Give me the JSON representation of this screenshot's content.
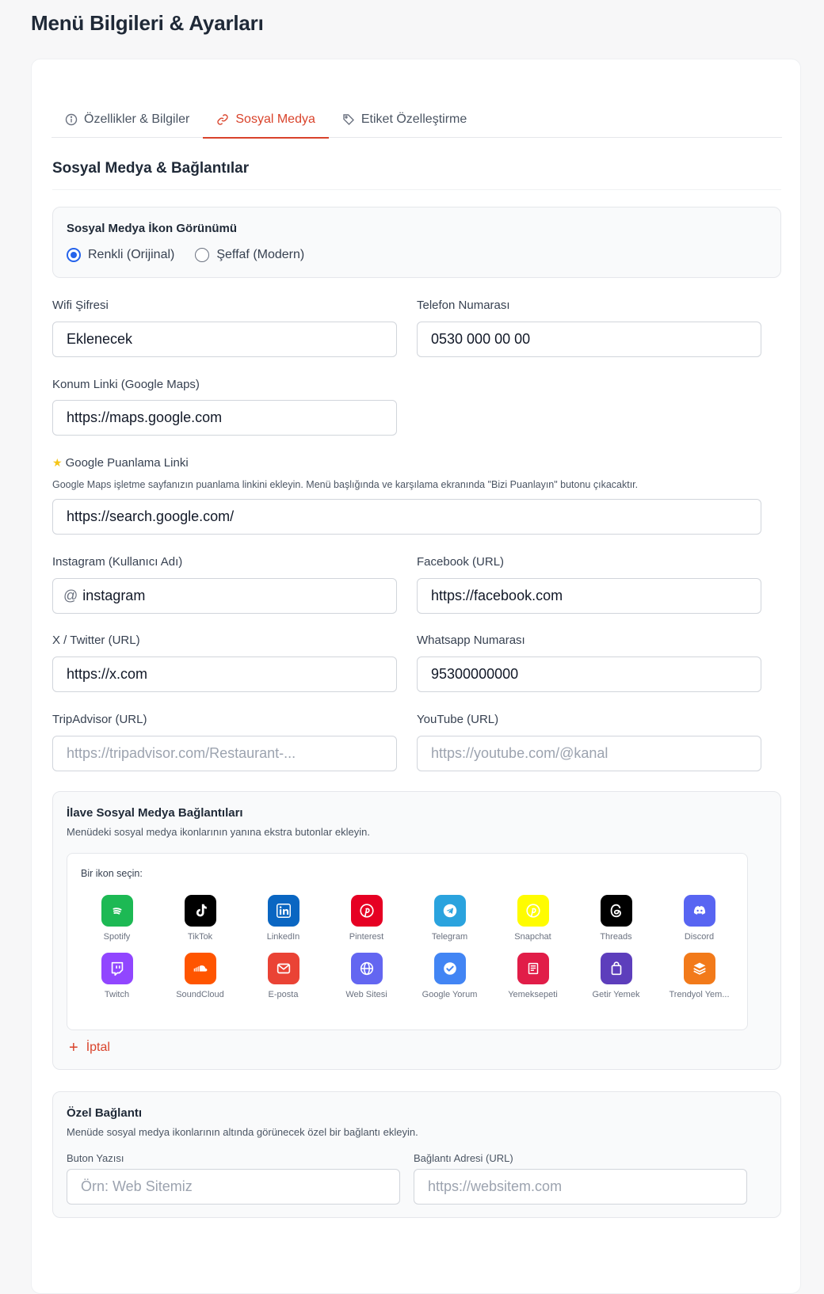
{
  "page_title": "Menü Bilgileri & Ayarları",
  "tabs": [
    {
      "label": "Özellikler & Bilgiler",
      "icon": "info-icon"
    },
    {
      "label": "Sosyal Medya",
      "icon": "link-icon",
      "active": true
    },
    {
      "label": "Etiket Özelleştirme",
      "icon": "tag-icon"
    }
  ],
  "section_title": "Sosyal Medya & Bağlantılar",
  "icon_view": {
    "title": "Sosyal Medya İkon Görünümü",
    "options": [
      {
        "label": "Renkli (Orijinal)",
        "checked": true
      },
      {
        "label": "Şeffaf (Modern)",
        "checked": false
      }
    ]
  },
  "fields": {
    "wifi": {
      "label": "Wifi Şifresi",
      "value": "Eklenecek"
    },
    "phone": {
      "label": "Telefon Numarası",
      "value": "0530 000 00 00"
    },
    "location": {
      "label": "Konum Linki (Google Maps)",
      "value": "https://maps.google.com"
    },
    "rating": {
      "label": "Google Puanlama Linki",
      "help": "Google Maps işletme sayfanızın puanlama linkini ekleyin. Menü başlığında ve karşılama ekranında \"Bizi Puanlayın\" butonu çıkacaktır.",
      "value": "https://search.google.com/"
    },
    "instagram": {
      "label": "Instagram (Kullanıcı Adı)",
      "prefix": "@",
      "value": "instagram"
    },
    "facebook": {
      "label": "Facebook (URL)",
      "value": "https://facebook.com"
    },
    "twitter": {
      "label": "X / Twitter (URL)",
      "value": "https://x.com"
    },
    "whatsapp": {
      "label": "Whatsapp Numarası",
      "value": "95300000000"
    },
    "tripadvisor": {
      "label": "TripAdvisor (URL)",
      "placeholder": "https://tripadvisor.com/Restaurant-..."
    },
    "youtube": {
      "label": "YouTube (URL)",
      "placeholder": "https://youtube.com/@kanal"
    }
  },
  "extra_links": {
    "title": "İlave Sosyal Medya Bağlantıları",
    "subtitle": "Menüdeki sosyal medya ikonlarının yanına ekstra butonlar ekleyin.",
    "picker_label": "Bir ikon seçin:",
    "icons": [
      {
        "name": "Spotify",
        "icon": "spotify-icon",
        "color": "#1db954"
      },
      {
        "name": "TikTok",
        "icon": "tiktok-icon",
        "color": "#000000"
      },
      {
        "name": "LinkedIn",
        "icon": "linkedin-icon",
        "color": "#0a66c2"
      },
      {
        "name": "Pinterest",
        "icon": "pinterest-icon",
        "color": "#e60023"
      },
      {
        "name": "Telegram",
        "icon": "telegram-icon",
        "color": "#2aa3de"
      },
      {
        "name": "Snapchat",
        "icon": "snapchat-icon",
        "color": "#fffc00"
      },
      {
        "name": "Threads",
        "icon": "threads-icon",
        "color": "#000000"
      },
      {
        "name": "Discord",
        "icon": "discord-icon",
        "color": "#5865f2"
      },
      {
        "name": "Twitch",
        "icon": "twitch-icon",
        "color": "#9146ff"
      },
      {
        "name": "SoundCloud",
        "icon": "soundcloud-icon",
        "color": "#ff5500"
      },
      {
        "name": "E-posta",
        "icon": "mail-icon",
        "color": "#ea4335"
      },
      {
        "name": "Web Sitesi",
        "icon": "globe-icon",
        "color": "#6366f1"
      },
      {
        "name": "Google Yorum",
        "icon": "check-badge-icon",
        "color": "#4285f4"
      },
      {
        "name": "Yemeksepeti",
        "icon": "yemeksepeti-icon",
        "color": "#e11d48"
      },
      {
        "name": "Getir Yemek",
        "icon": "shopping-bag-icon",
        "color": "#5d3ebc"
      },
      {
        "name": "Trendyol Yem...",
        "icon": "layers-icon",
        "color": "#f27a1a"
      }
    ],
    "cancel_label": "İptal"
  },
  "custom_link": {
    "title": "Özel Bağlantı",
    "subtitle": "Menüde sosyal medya ikonlarının altında görünecek özel bir bağlantı ekleyin.",
    "button_text": {
      "label": "Buton Yazısı",
      "placeholder": "Örn: Web Sitemiz"
    },
    "url": {
      "label": "Bağlantı Adresi (URL)",
      "placeholder": "https://websitem.com"
    }
  }
}
